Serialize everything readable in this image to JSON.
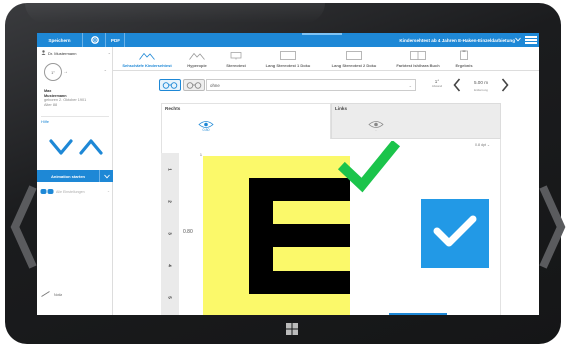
{
  "topbar": {
    "save_label": "Speichern",
    "pdf_label": "PDF",
    "title": "Kindersehtest ab 4 Jahren E-Haken-Einzeldarbietung"
  },
  "sidebar": {
    "doctor": "Dr. Mustermann",
    "patient": {
      "circle_label": "1°",
      "name_line1": "Max",
      "name_line2": "Mustermann",
      "born": "geboren 2. Oktober 1901",
      "age": "Alter 88"
    },
    "help_label": "Hilfe",
    "animation_label": "Animation starten",
    "glasses_placeholder": "Alle Einstellungen"
  },
  "tabs": [
    {
      "label": "Sehschärfe Kindersehtest",
      "active": true
    },
    {
      "label": "Hyperopie",
      "active": false
    },
    {
      "label": "Stereotest",
      "active": false
    },
    {
      "label": "Lang Stereotest 1 Doku",
      "active": false
    },
    {
      "label": "Lang Stereotest 2 Doku",
      "active": false
    },
    {
      "label": "Farbtest Ishihara Buch",
      "active": false
    },
    {
      "label": "Ergebnis",
      "active": false
    }
  ],
  "controls": {
    "correction_value": "ohne",
    "abstand_value": "1°",
    "abstand_label": "Abstand",
    "entfernung_value": "5.00",
    "entfernung_unit": "m",
    "entfernung_label": "Entfernung"
  },
  "panels": {
    "rechts": {
      "title": "Rechts",
      "value": "0.80"
    },
    "links": {
      "title": "Links",
      "value": "-"
    }
  },
  "chart": {
    "scale_label": "0.8 dpt",
    "row_numbers": [
      "1",
      "2",
      "3",
      "4",
      "5"
    ],
    "acuity_value": "0.80",
    "small_number": "1"
  },
  "colors": {
    "accent": "#1e88d6",
    "card": "#fbf96a",
    "check_green": "#1bc44b",
    "confirm_button": "#2299e6"
  },
  "icons": {
    "next_row": "chevron-down-icon",
    "prev_row": "chevron-up-icon",
    "confirm": "checkmark-icon",
    "optotype": "letter-e-optotype"
  }
}
